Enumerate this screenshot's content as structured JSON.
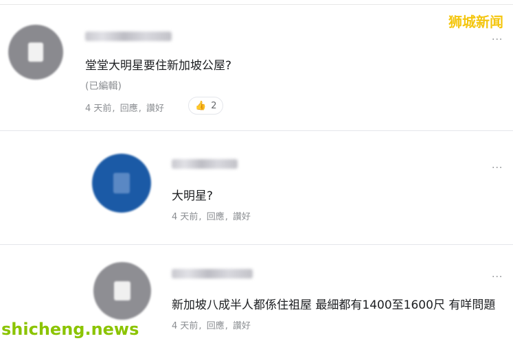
{
  "watermarks": {
    "top_right": "狮城新闻",
    "bottom_left": "shicheng.news"
  },
  "comments": [
    {
      "text": "堂堂大明星要住新加坡公屋?",
      "edited": "(已編輯)",
      "time": "4 天前",
      "reply": "回應",
      "like": "讚好",
      "likes": "2",
      "avatar_color": "#8a8a8f"
    },
    {
      "text": "大明星?",
      "time": "4 天前",
      "reply": "回應",
      "like": "讚好",
      "avatar_color": "#1b5aa6"
    },
    {
      "text": "新加坡八成半人都係住祖屋 最細都有1400至1600尺 有咩問題",
      "time": "4 天前",
      "reply": "回應",
      "like": "讚好",
      "avatar_color": "#8e8e93"
    }
  ],
  "more_icon": "···"
}
